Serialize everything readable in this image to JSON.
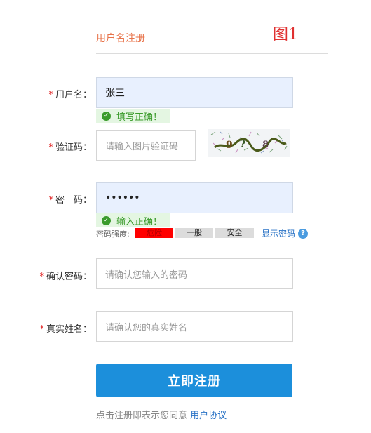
{
  "form": {
    "title": "用户名注册",
    "figure_label": "图1"
  },
  "username": {
    "required_mark": "*",
    "label": "用户名：",
    "value": "张三",
    "validation": "填写正确！"
  },
  "captcha": {
    "required_mark": "*",
    "label": "验证码：",
    "placeholder": "请输入图片验证码"
  },
  "password": {
    "required_mark": "*",
    "label": "密　码：",
    "value": "••••••",
    "validation": "输入正确！",
    "strength_label": "密码强度:",
    "strength_levels": [
      "危险",
      "一般",
      "安全"
    ],
    "strength_current": "危险",
    "show_password": "显示密码"
  },
  "confirm_password": {
    "required_mark": "*",
    "label": "确认密码：",
    "placeholder": "请确认您输入的密码"
  },
  "real_name": {
    "required_mark": "*",
    "label": "真实姓名：",
    "placeholder": "请确认您的真实姓名"
  },
  "submit": {
    "label": "立即注册"
  },
  "agreement": {
    "text": "点击注册即表示您同意",
    "link": "用户协议"
  },
  "colors": {
    "title": "#e8734a",
    "required": "#e02020",
    "success": "#3b9b2c",
    "danger": "#ff0000",
    "primary": "#1c8fdb",
    "link": "#2a73c6"
  }
}
